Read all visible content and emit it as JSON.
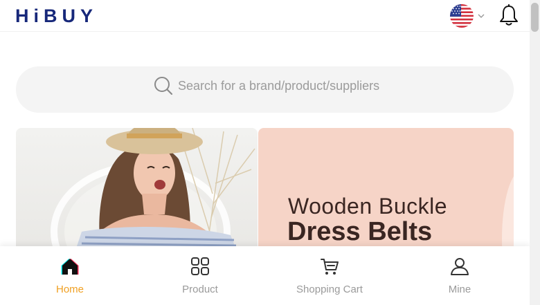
{
  "header": {
    "logo": "HiBUY",
    "language_flag_icon": "us-flag-icon",
    "dropdown_icon": "chevron-down-icon",
    "notification_icon": "bell-icon"
  },
  "search": {
    "placeholder": "Search for a brand/product/suppliers",
    "icon": "search-icon"
  },
  "banners": {
    "right": {
      "line1": "Wooden Buckle",
      "line2": "Dress Belts"
    }
  },
  "bottom_nav": {
    "items": [
      {
        "label": "Home",
        "icon": "home-icon",
        "active": true
      },
      {
        "label": "Product",
        "icon": "grid-icon",
        "active": false
      },
      {
        "label": "Shopping Cart",
        "icon": "cart-icon",
        "active": false
      },
      {
        "label": "Mine",
        "icon": "user-icon",
        "active": false
      }
    ]
  },
  "colors": {
    "brand": "#17287a",
    "active": "#f0a023",
    "inactive": "#9a9a9a",
    "banner_right_bg": "#f6d4c7"
  }
}
